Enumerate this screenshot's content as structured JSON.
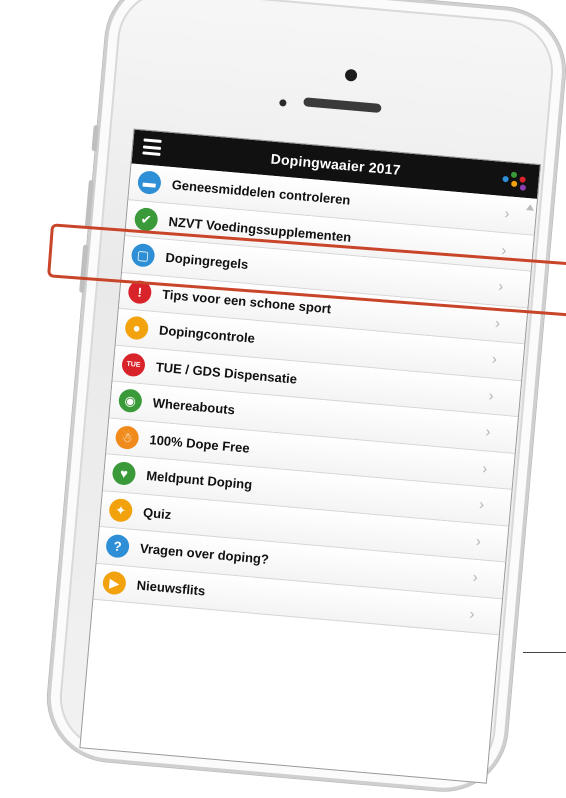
{
  "app": {
    "title": "Dopingwaaier 2017",
    "menu_icon": "hamburger-icon",
    "logo_icon": "dots-logo-icon"
  },
  "menu": {
    "items": [
      {
        "label": "Geneesmiddelen controleren",
        "icon": "pill-icon",
        "glyph": "▬",
        "color": "#2e8fd6"
      },
      {
        "label": "NZVT Voedingssupplementen",
        "icon": "checkmark-icon",
        "glyph": "✔",
        "color": "#3a9a3a"
      },
      {
        "label": "Dopingregels",
        "icon": "book-icon",
        "glyph": "▢",
        "color": "#2e8fd6"
      },
      {
        "label": "Tips voor een schone sport",
        "icon": "warning-icon",
        "glyph": "!",
        "color": "#d8232a"
      },
      {
        "label": "Dopingcontrole",
        "icon": "drop-icon",
        "glyph": "●",
        "color": "#f2a20c"
      },
      {
        "label": "TUE / GDS Dispensatie",
        "icon": "tue-gds-icon",
        "glyph": "TUE",
        "color": "#d8232a"
      },
      {
        "label": "Whereabouts",
        "icon": "location-pin-icon",
        "glyph": "◉",
        "color": "#3a9a3a"
      },
      {
        "label": "100% Dope Free",
        "icon": "person-icon",
        "glyph": "☃",
        "color": "#f08a1a"
      },
      {
        "label": "Meldpunt Doping",
        "icon": "handshake-icon",
        "glyph": "♥",
        "color": "#3a9a3a"
      },
      {
        "label": "Quiz",
        "icon": "puzzle-icon",
        "glyph": "✦",
        "color": "#f2a20c"
      },
      {
        "label": "Vragen over doping?",
        "icon": "question-icon",
        "glyph": "?",
        "color": "#2e8fd6"
      },
      {
        "label": "Nieuwsflits",
        "icon": "megaphone-icon",
        "glyph": "▶",
        "color": "#f2a20c"
      }
    ],
    "chevron": "›",
    "highlighted_item": "NZVT Voedingssupplementen"
  },
  "colors": {
    "appbar": "#111111",
    "highlight": "#c8452a"
  }
}
